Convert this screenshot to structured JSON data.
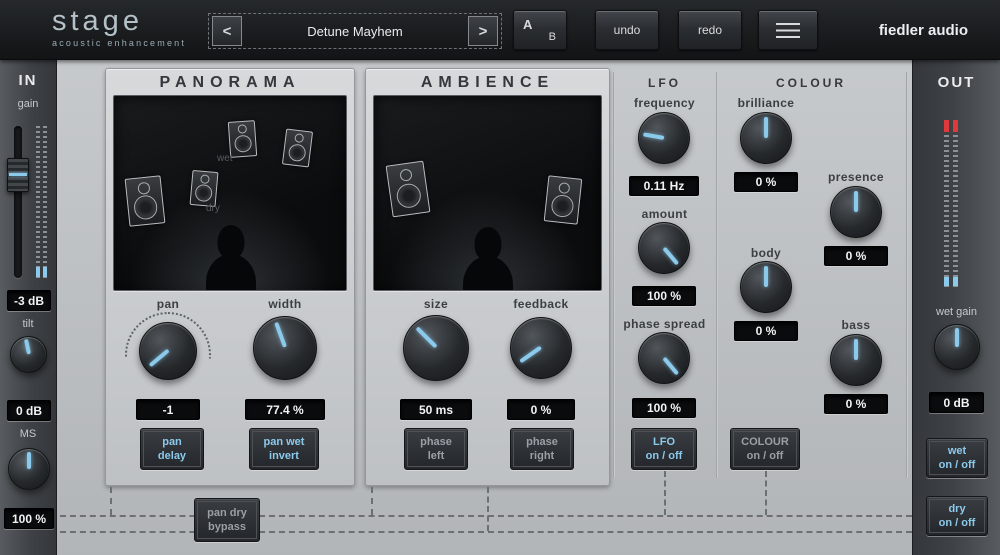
{
  "header": {
    "logo": "stage",
    "tagline": "acoustic enhancement",
    "preset_prev": "<",
    "preset_name": "Detune Mayhem",
    "preset_next": ">",
    "ab_a": "A",
    "ab_b": "B",
    "undo": "undo",
    "redo": "redo",
    "brand": "fiedler audio"
  },
  "in_panel": {
    "title": "IN",
    "gain_label": "gain",
    "gain_value": "-3 dB",
    "tilt_label": "tilt",
    "tilt_value": "0 dB",
    "ms_label": "MS",
    "ms_value": "100 %"
  },
  "panorama": {
    "title": "PANORAMA",
    "wet_label": "wet",
    "dry_label": "dry",
    "pan_label": "pan",
    "pan_value": "-1",
    "width_label": "width",
    "width_value": "77.4 %",
    "pan_delay_l1": "pan",
    "pan_delay_l2": "delay",
    "pan_wet_invert_l1": "pan wet",
    "pan_wet_invert_l2": "invert",
    "pan_dry_bypass_l1": "pan dry",
    "pan_dry_bypass_l2": "bypass"
  },
  "ambience": {
    "title": "AMBIENCE",
    "size_label": "size",
    "size_value": "50 ms",
    "feedback_label": "feedback",
    "feedback_value": "0 %",
    "phase_left_l1": "phase",
    "phase_left_l2": "left",
    "phase_right_l1": "phase",
    "phase_right_l2": "right"
  },
  "lfo": {
    "title": "LFO",
    "frequency_label": "frequency",
    "frequency_value": "0.11 Hz",
    "amount_label": "amount",
    "amount_value": "100 %",
    "phase_spread_label": "phase spread",
    "phase_spread_value": "100 %",
    "onoff_l1": "LFO",
    "onoff_l2": "on / off"
  },
  "colour": {
    "title": "COLOUR",
    "brilliance_label": "brilliance",
    "brilliance_value": "0 %",
    "presence_label": "presence",
    "presence_value": "0 %",
    "body_label": "body",
    "body_value": "0 %",
    "bass_label": "bass",
    "bass_value": "0 %",
    "onoff_l1": "COLOUR",
    "onoff_l2": "on / off"
  },
  "out_panel": {
    "title": "OUT",
    "wet_gain_label": "wet gain",
    "wet_gain_value": "0 dB",
    "wet_onoff_l1": "wet",
    "wet_onoff_l2": "on / off",
    "dry_onoff_l1": "dry",
    "dry_onoff_l2": "on / off"
  },
  "colors": {
    "accent_blue": "#8ccaec",
    "clip_red": "#e0393c"
  }
}
